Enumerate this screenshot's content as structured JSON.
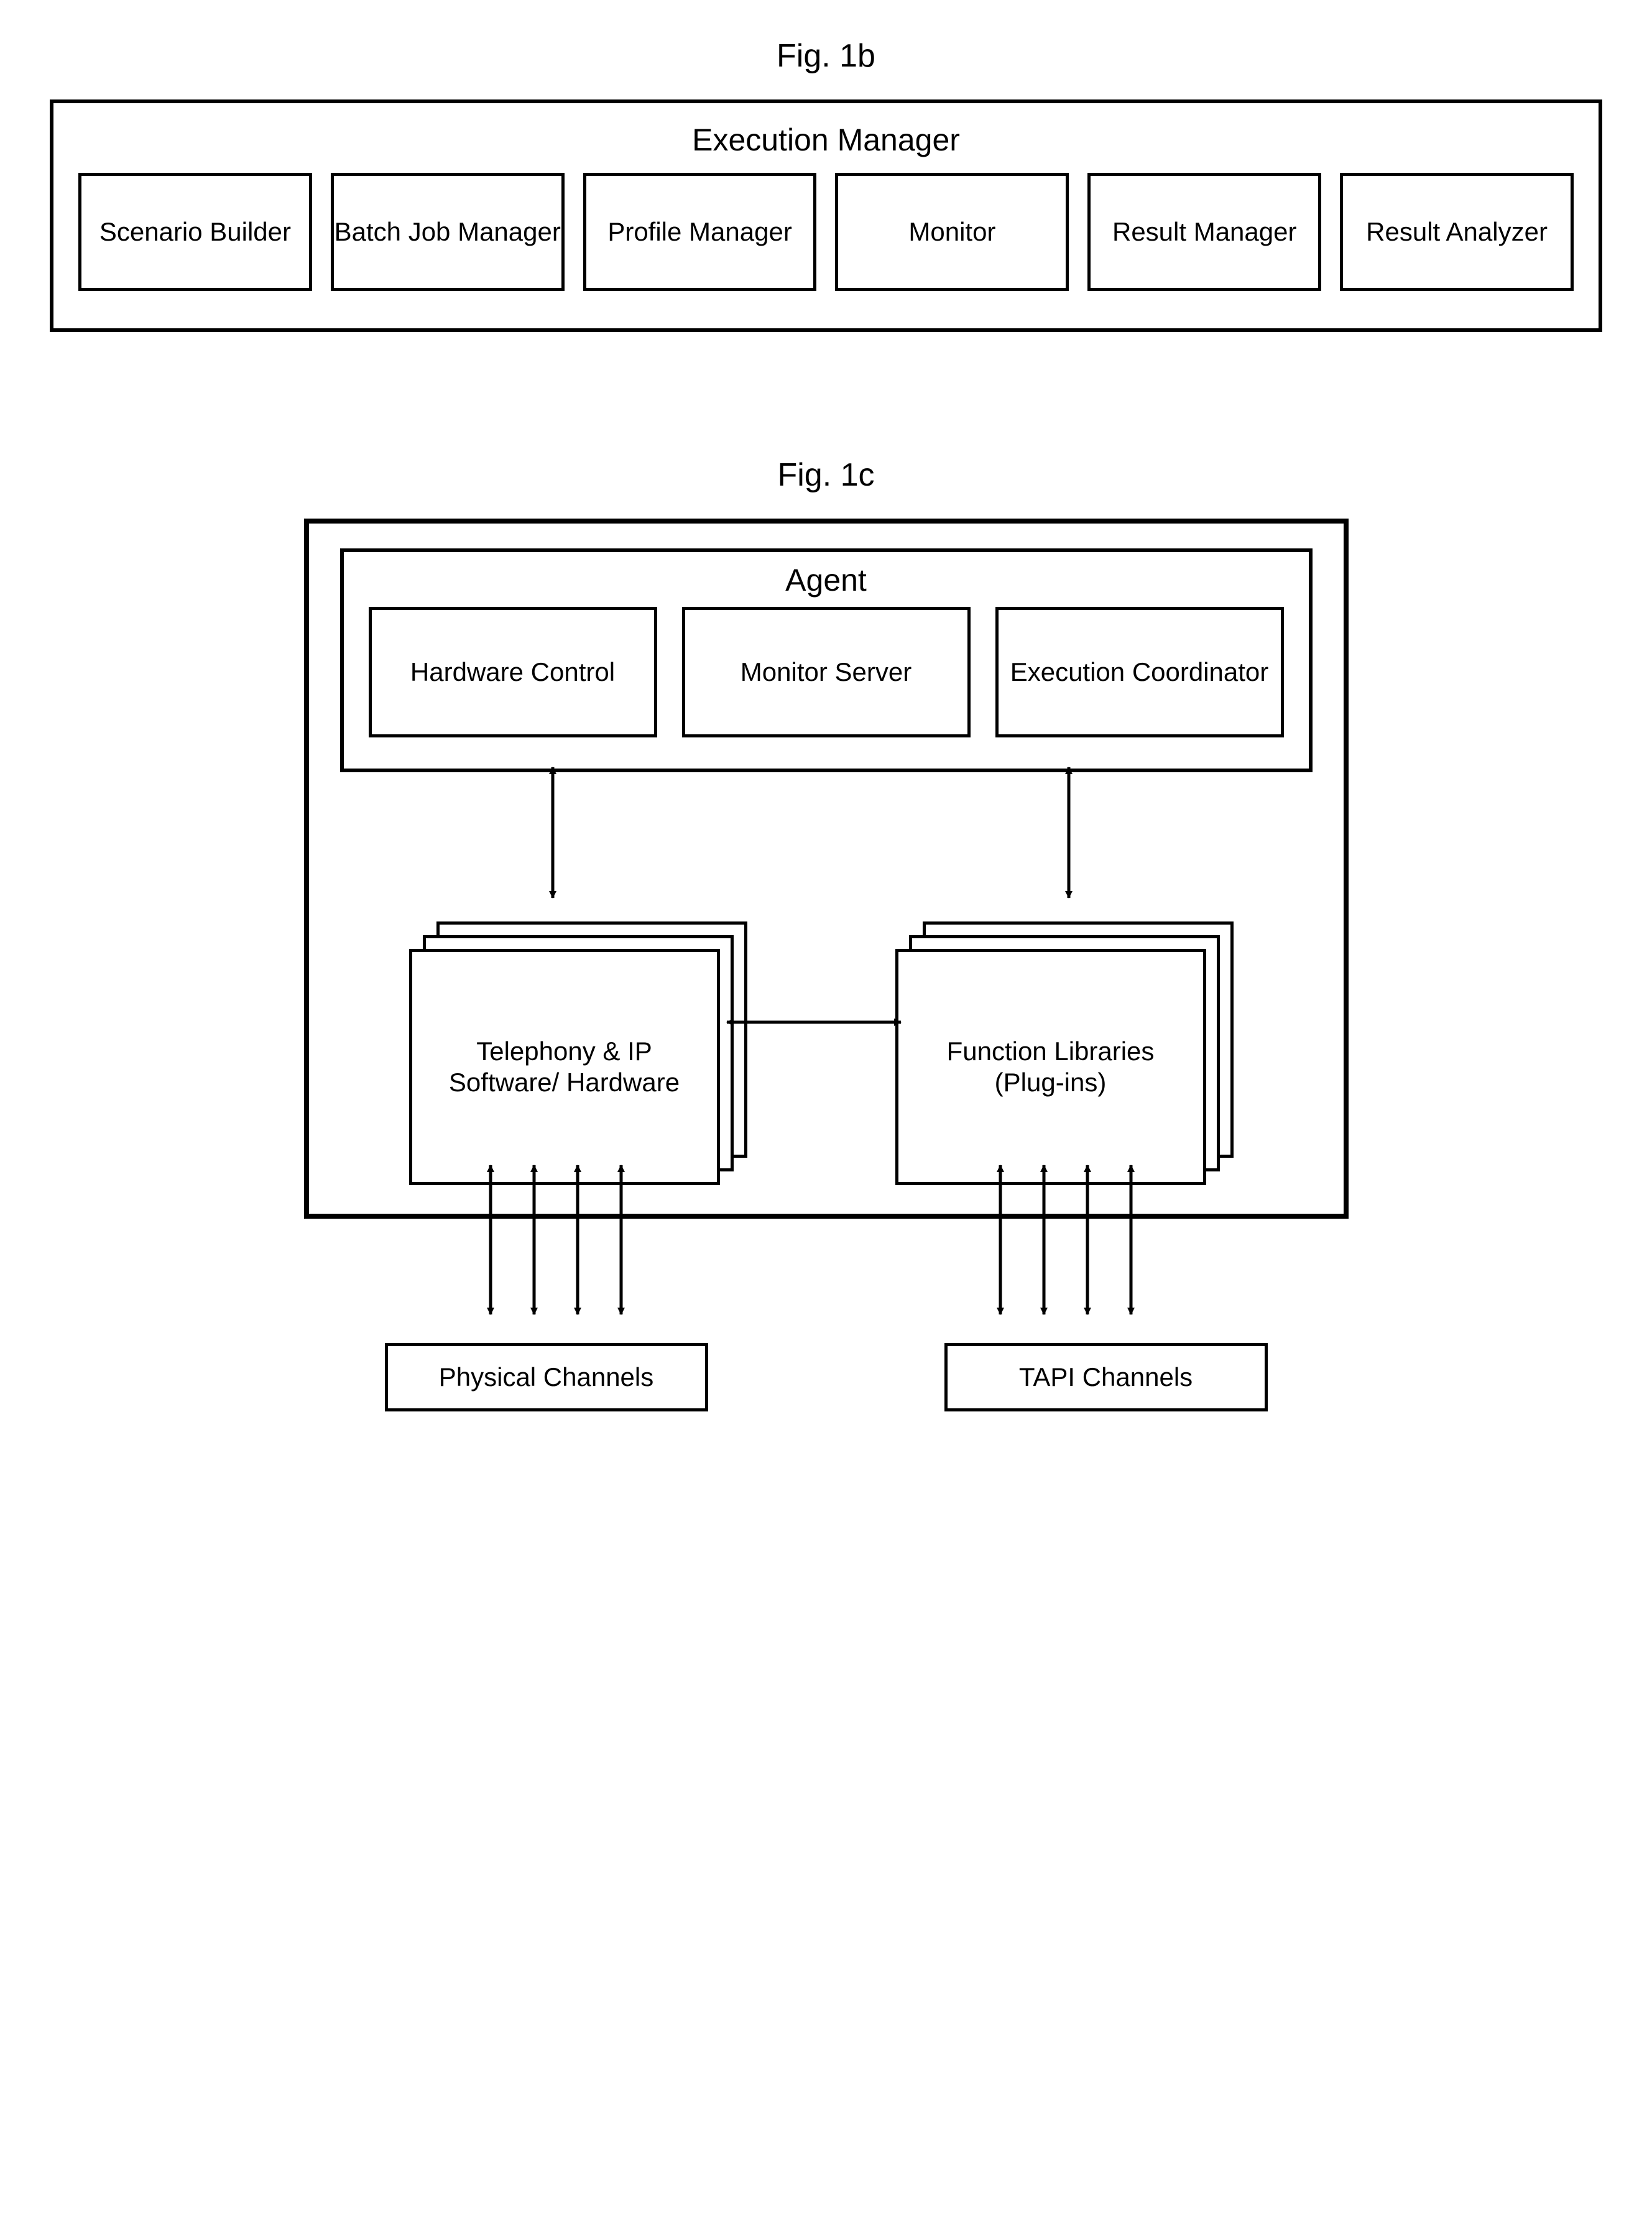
{
  "fig1b": {
    "label": "Fig. 1b",
    "title": "Execution Manager",
    "boxes": [
      "Scenario Builder",
      "Batch Job Manager",
      "Profile Manager",
      "Monitor",
      "Result Manager",
      "Result Analyzer"
    ]
  },
  "fig1c": {
    "label": "Fig. 1c",
    "agent_title": "Agent",
    "agent_boxes": [
      "Hardware Control",
      "Monitor Server",
      "Execution Coordinator"
    ],
    "mid_left": "Telephony & IP Software/ Hardware",
    "mid_right": "Function Libraries (Plug-ins)",
    "ext_left": "Physical Channels",
    "ext_right": "TAPI  Channels"
  }
}
